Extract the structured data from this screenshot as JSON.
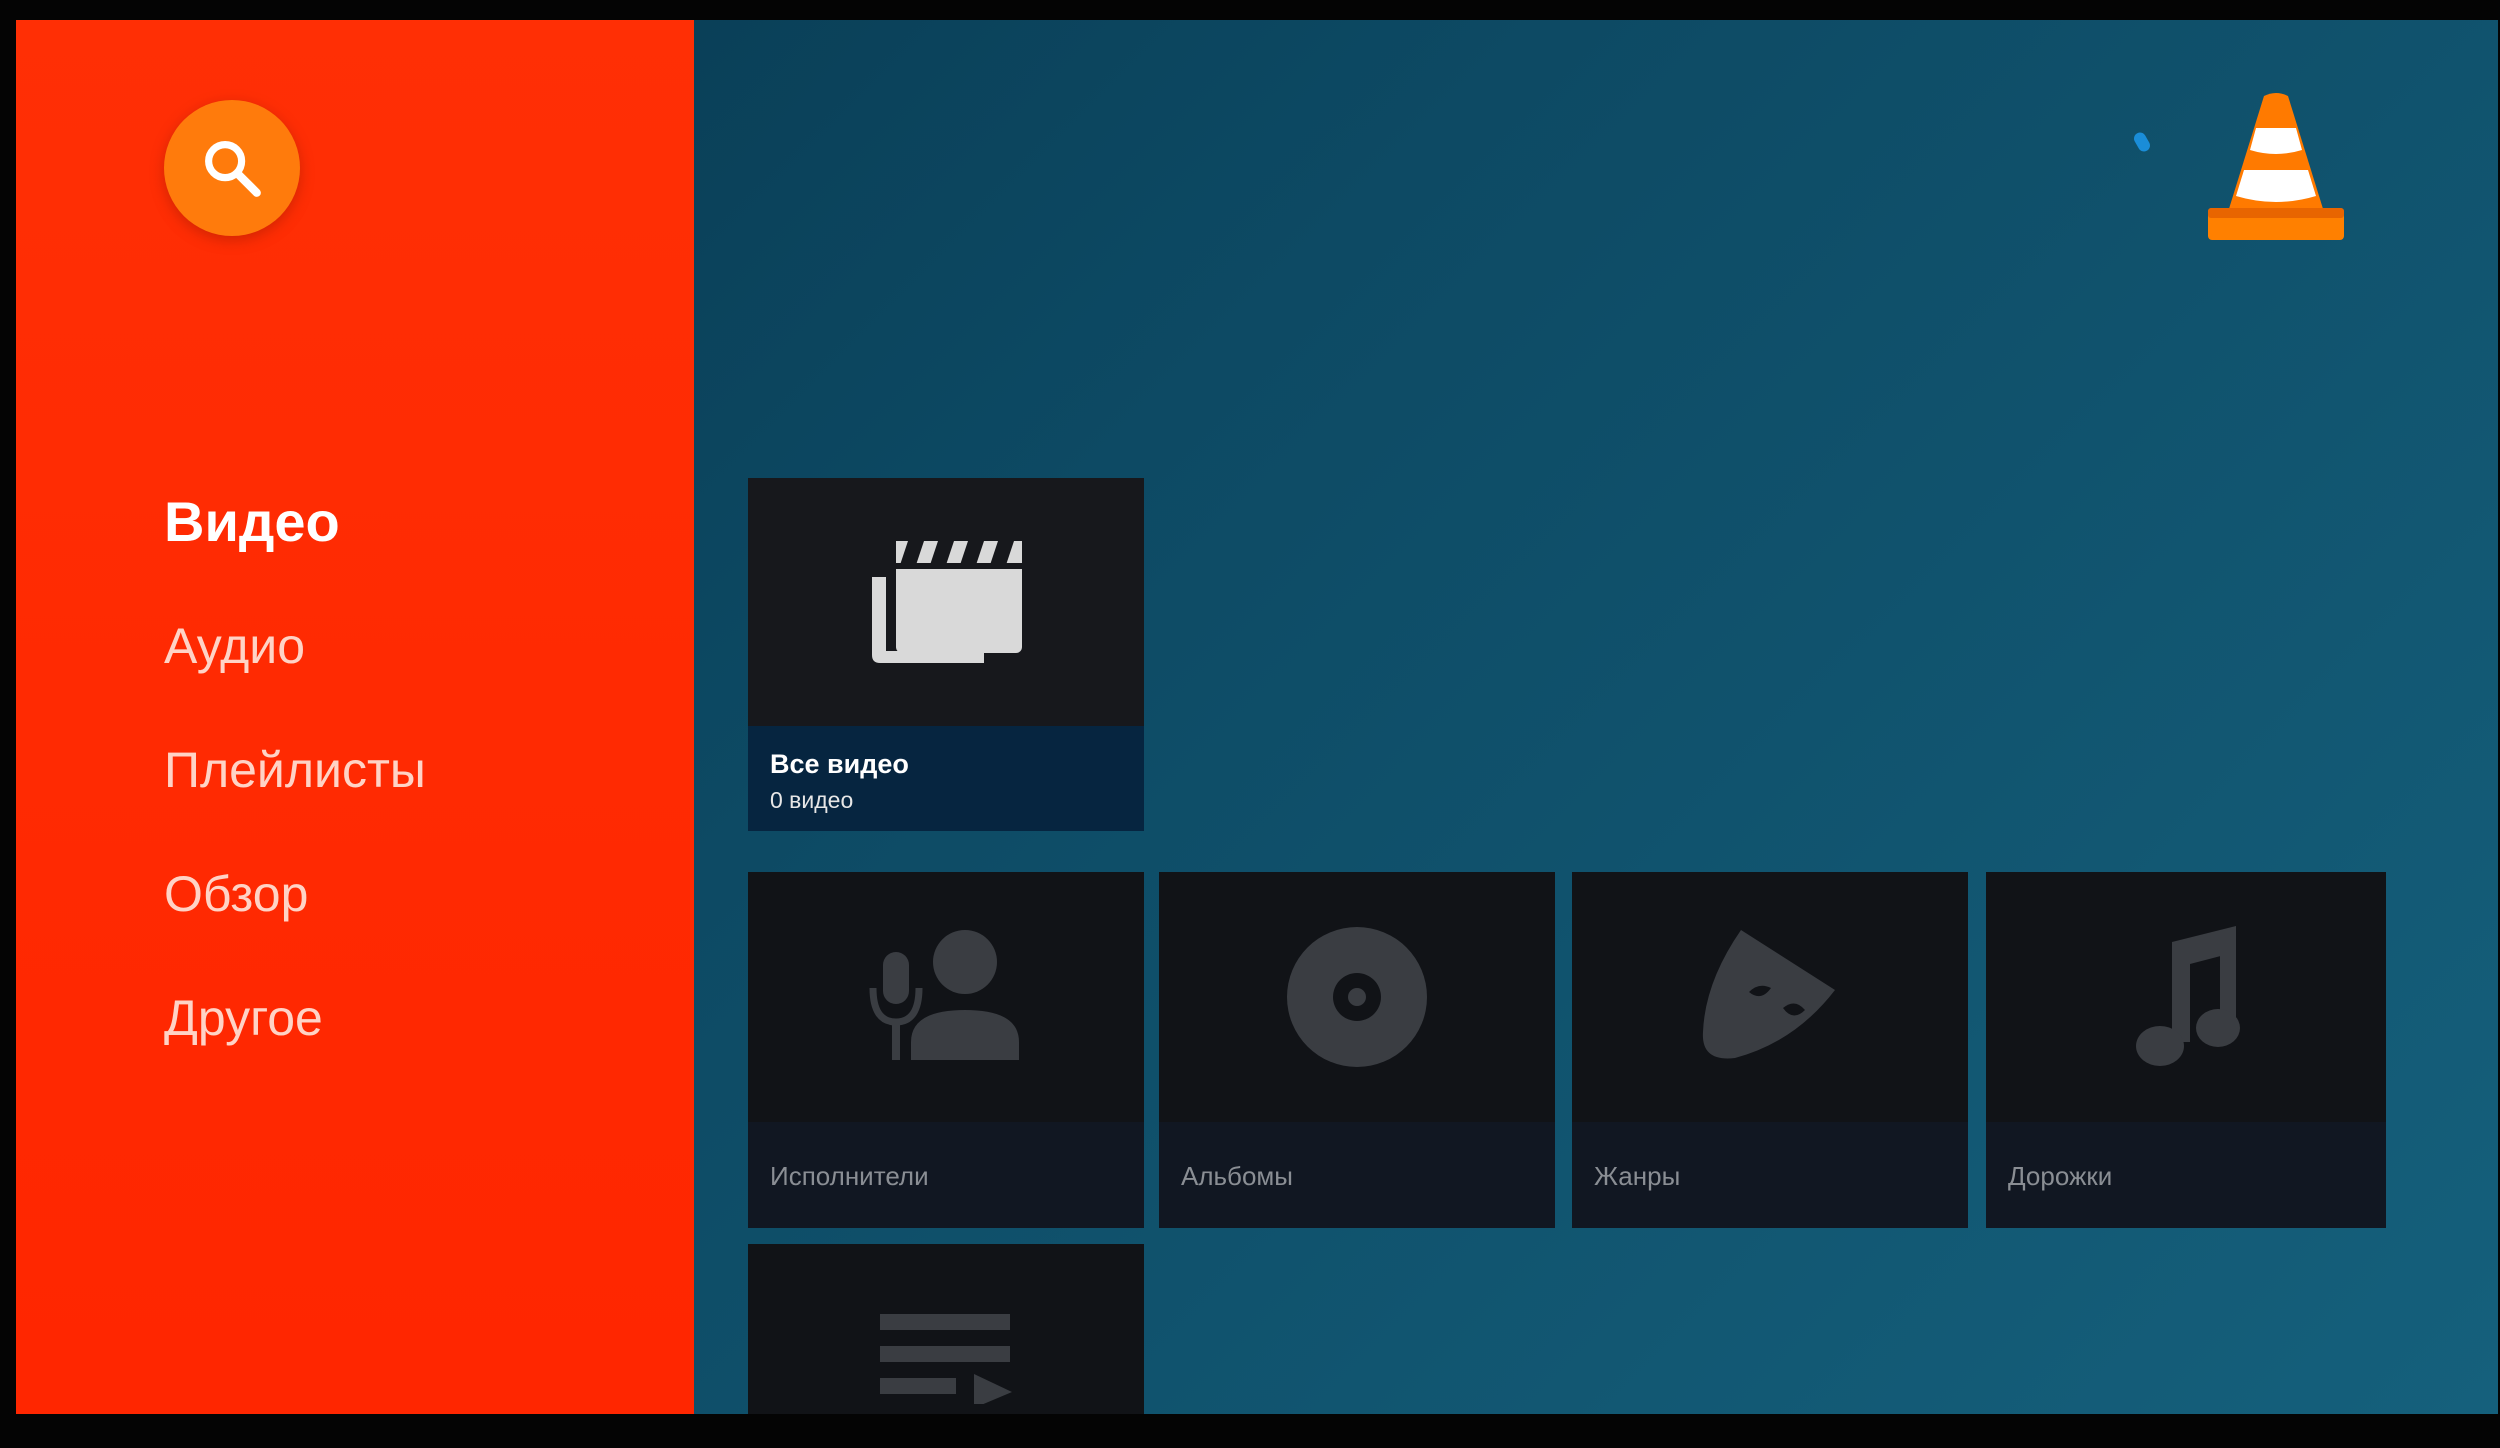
{
  "sidebar": {
    "search_icon": "search-icon",
    "nav_items": [
      {
        "label": "Видео",
        "active": true
      },
      {
        "label": "Аудио",
        "active": false
      },
      {
        "label": "Плейлисты",
        "active": false
      },
      {
        "label": "Обзор",
        "active": false
      },
      {
        "label": "Другое",
        "active": false
      }
    ]
  },
  "header": {
    "logo": "vlc-cone-logo",
    "loading_indicator": "spinner"
  },
  "video": {
    "all_videos": {
      "title": "Все видео",
      "subtitle": "0 видео",
      "icon": "movie-clapper-icon"
    }
  },
  "audio": {
    "cards": [
      {
        "label": "Исполнители",
        "icon": "artist-mic-icon"
      },
      {
        "label": "Альбомы",
        "icon": "album-disc-icon"
      },
      {
        "label": "Жанры",
        "icon": "genre-mask-icon"
      },
      {
        "label": "Дорожки",
        "icon": "music-note-icon"
      }
    ]
  },
  "playlists": {
    "icon": "playlist-icon"
  },
  "colors": {
    "sidebar": "#ff2a02",
    "search_button": "#ff7b0c",
    "content_background": "#0d4a64",
    "card_background": "#121418",
    "featured_caption": "#062540",
    "logo_orange": "#ff7a00"
  }
}
